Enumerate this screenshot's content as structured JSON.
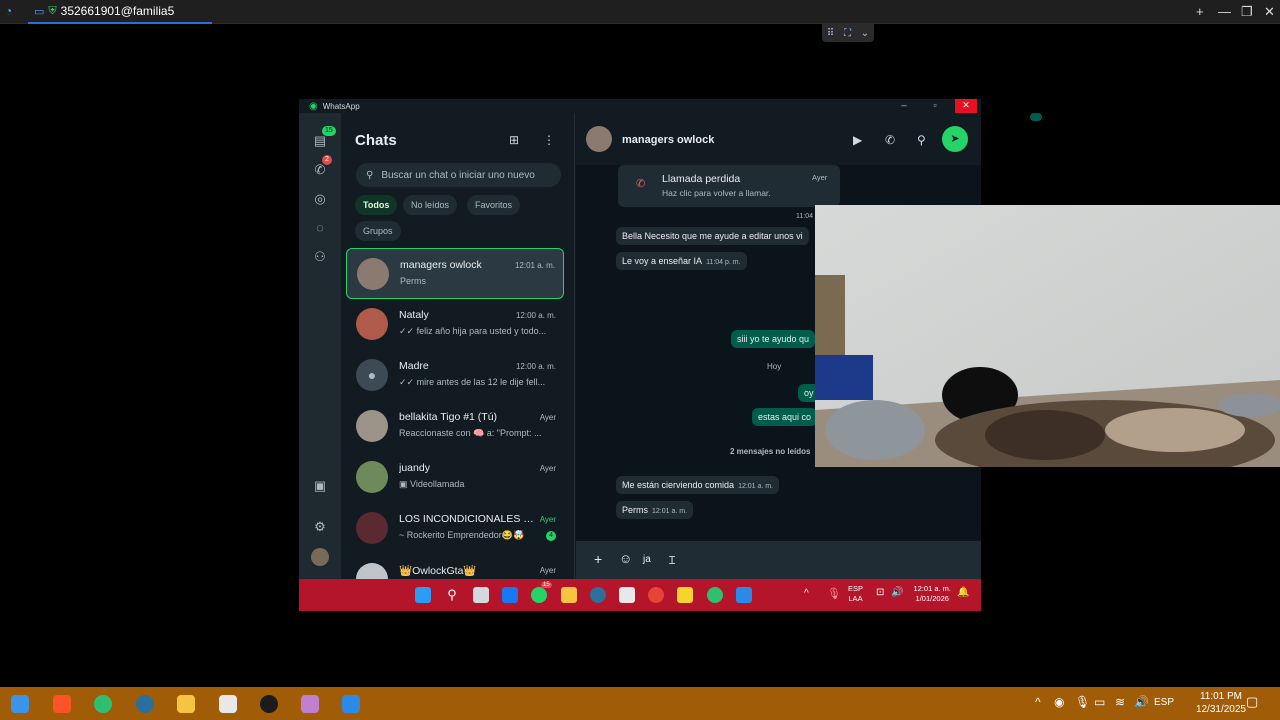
{
  "remote": {
    "session_title": "352661901@familia5",
    "controls": {
      "add": "+",
      "minimize": "—",
      "restore": "❐",
      "close": "✕"
    }
  },
  "whatsapp": {
    "window_title": "WhatsApp",
    "rail": {
      "chats_badge": "15",
      "calls_badge": "2"
    },
    "list": {
      "title": "Chats",
      "search_placeholder": "Buscar un chat o iniciar uno nuevo",
      "filters": [
        "Todos",
        "No leídos",
        "Favoritos",
        "Grupos"
      ],
      "chats": [
        {
          "name": "managers owlock",
          "preview": "Perms",
          "time": "12:01 a. m."
        },
        {
          "name": "Nataly",
          "preview": "✓✓ feliz año hija para usted y todo...",
          "time": "12:00 a. m."
        },
        {
          "name": "Madre",
          "preview": "✓✓ mire antes de las 12 le dije fell...",
          "time": "12:00 a. m."
        },
        {
          "name": "bellakita Tigo #1 (Tú)",
          "preview": "Reaccionaste con 🧠 a: \"Prompt: ...",
          "time": "Ayer"
        },
        {
          "name": "juandy",
          "preview": "▣ Videollamada",
          "time": "Ayer"
        },
        {
          "name": "LOS INCONDICIONALES D...",
          "preview": "~ Rockerito Emprendedor😂🤯",
          "time": "Ayer",
          "unread": "4"
        },
        {
          "name": "👑OwlockGta👑",
          "preview": "",
          "time": "Ayer"
        }
      ]
    },
    "conversation": {
      "name": "managers owlock",
      "missed_call": {
        "title": "Llamada perdida",
        "subtitle": "Haz clic para volver a llamar.",
        "time": "Ayer"
      },
      "time_1104": "11:04",
      "msg1": "Bella Necesito que me ayude a editar unos vi",
      "msg2": "Le voy a enseñar IA",
      "msg2_time": "11:04 p. m.",
      "out1": "siii yo te ayudo qu",
      "day_hoy": "Hoy",
      "out2": "oy",
      "out3": "estas aqui co",
      "unread_marker": "2 mensajes no leídos",
      "msg3": "Me están cierviendo comida",
      "msg3_time": "12:01 a. m.",
      "msg4": "Perms",
      "msg4_time": "12:01 a. m.",
      "composer_text": "ja"
    }
  },
  "inner_taskbar": {
    "lang_top": "ESP",
    "lang_bottom": "LAA",
    "time": "12:01 a. m.",
    "date": "1/01/2026",
    "whatsapp_badge": "15"
  },
  "host_taskbar": {
    "lang": "ESP",
    "time": "11:01 PM",
    "date": "12/31/2025"
  }
}
